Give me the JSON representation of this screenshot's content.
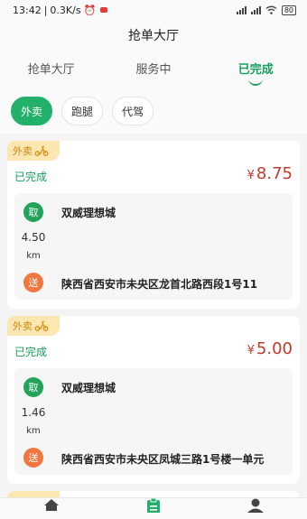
{
  "status_bar": {
    "time": "13:42",
    "speed": "0.3K/s",
    "battery": "80"
  },
  "title": "抢单大厅",
  "tabs": [
    {
      "label": "抢单大厅"
    },
    {
      "label": "服务中"
    },
    {
      "label": "已完成"
    }
  ],
  "filters": [
    {
      "label": "外卖"
    },
    {
      "label": "跑腿"
    },
    {
      "label": "代驾"
    }
  ],
  "orders": [
    {
      "type": "外卖",
      "status": "已完成",
      "currency": "¥",
      "price": "8.75",
      "pickup_label": "取",
      "pickup_name": "双威理想城",
      "distance": "4.50",
      "distance_unit": "km",
      "dropoff_label": "送",
      "dropoff_address": "陕西省西安市未央区龙首北路西段1号11"
    },
    {
      "type": "外卖",
      "status": "已完成",
      "currency": "¥",
      "price": "5.00",
      "pickup_label": "取",
      "pickup_name": "双威理想城",
      "distance": "1.46",
      "distance_unit": "km",
      "dropoff_label": "送",
      "dropoff_address": "陕西省西安市未央区凤城三路1号楼一单元"
    }
  ],
  "colors": {
    "accent": "#22b06b",
    "price": "#c0392b",
    "dropoff": "#f07840"
  },
  "bottom_nav": [
    {
      "icon": "home-icon"
    },
    {
      "icon": "orders-icon"
    },
    {
      "icon": "profile-icon"
    }
  ]
}
